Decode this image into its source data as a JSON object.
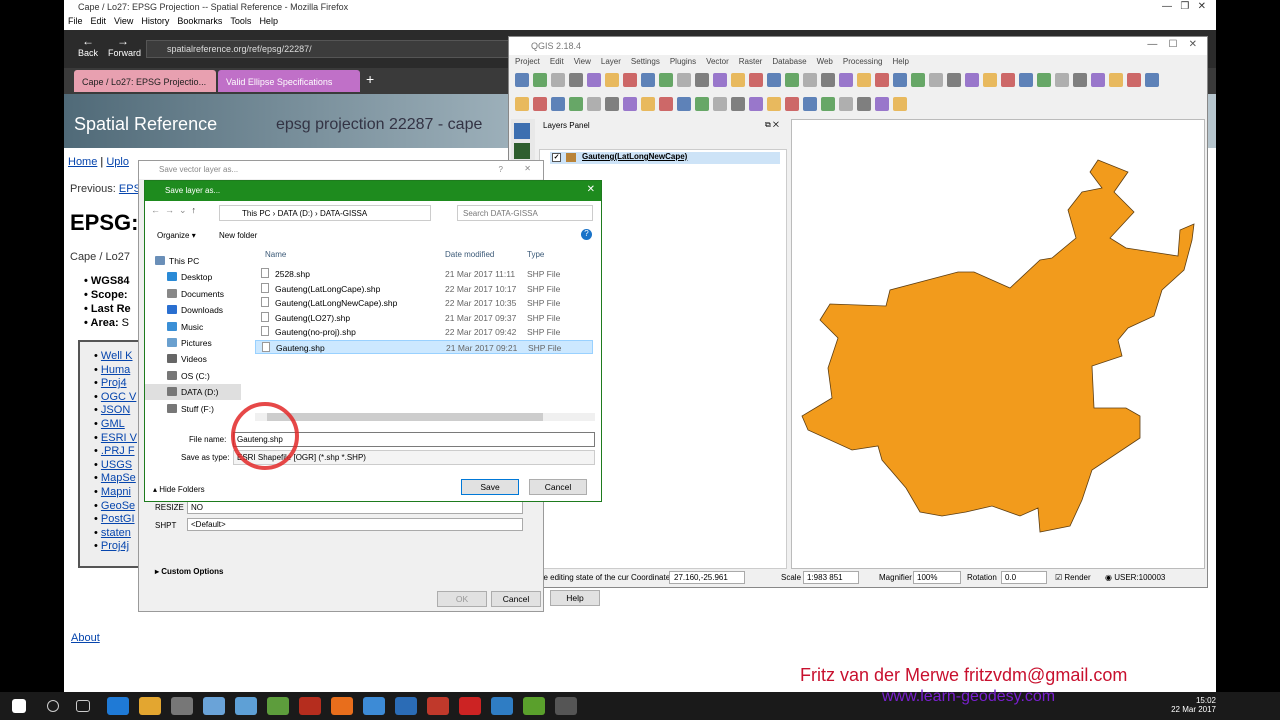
{
  "firefox": {
    "title": "Cape / Lo27: EPSG Projection -- Spatial Reference - Mozilla Firefox",
    "menu": [
      "File",
      "Edit",
      "View",
      "History",
      "Bookmarks",
      "Tools",
      "Help"
    ],
    "back": "Back",
    "forward": "Forward",
    "url": "spatialreference.org/ref/epsg/22287/",
    "tabs": [
      "Cape / Lo27: EPSG Projectio...",
      "Valid Ellipse Specifications"
    ],
    "new_tab": "+"
  },
  "page": {
    "brand": "Spatial Reference",
    "heading_right": "epsg projection 22287 - cape",
    "nav": [
      "Home",
      "Uplo"
    ],
    "previous": "Previous:",
    "previous_link": "EPS",
    "big_title": "EPSG:",
    "subtitle": "Cape / Lo27",
    "props": [
      {
        "k": "WGS84"
      },
      {
        "k": "Scope:"
      },
      {
        "k": "Last Re"
      },
      {
        "k": "Area:",
        "v": "S"
      }
    ],
    "links": [
      "Well K",
      "Huma",
      "Proj4",
      "OGC V",
      "JSON",
      "GML",
      "ESRI V",
      ".PRJ F",
      "USGS",
      "MapSe",
      "Mapni",
      "GeoSe",
      "PostGI",
      "staten",
      "Proj4j"
    ],
    "about": "About"
  },
  "qgis": {
    "title": "QGIS 2.18.4",
    "menu": [
      "Project",
      "Edit",
      "View",
      "Layer",
      "Settings",
      "Plugins",
      "Vector",
      "Raster",
      "Database",
      "Web",
      "Processing",
      "Help"
    ],
    "layers_panel": "Layers Panel",
    "layer": "Gauteng(LatLongNewCape)",
    "status": {
      "msg": "he editing state of the cur",
      "coord_label": "Coordinate",
      "coord": "27.160,-25.961",
      "scale_label": "Scale",
      "scale": "1:983 851",
      "mag_label": "Magnifier",
      "mag": "100%",
      "rot_label": "Rotation",
      "rot": "0.0",
      "render": "Render",
      "crs": "USER:100003"
    },
    "fill_color": "#f29b1c"
  },
  "save_vector": {
    "title": "Save vector layer as...",
    "help": "?",
    "rows": [
      {
        "k": "RESIZE",
        "v": "NO"
      },
      {
        "k": "SHPT",
        "v": "<Default>"
      }
    ],
    "custom": "Custom Options",
    "ok": "OK",
    "cancel": "Cancel",
    "help_btn": "Help"
  },
  "save_layer": {
    "title": "Save layer as...",
    "crumbs": [
      "This PC",
      "DATA (D:)",
      "DATA-GISSA"
    ],
    "search": "Search DATA-GISSA",
    "organize": "Organize",
    "new_folder": "New folder",
    "cols": [
      "Name",
      "Date modified",
      "Type"
    ],
    "nav": [
      "This PC",
      "Desktop",
      "Documents",
      "Downloads",
      "Music",
      "Pictures",
      "Videos",
      "OS (C:)",
      "DATA (D:)",
      "Stuff (F:)"
    ],
    "files": [
      {
        "name": "2528.shp",
        "date": "21 Mar 2017 11:11",
        "type": "SHP File"
      },
      {
        "name": "Gauteng(LatLongCape).shp",
        "date": "22 Mar 2017 10:17",
        "type": "SHP File"
      },
      {
        "name": "Gauteng(LatLongNewCape).shp",
        "date": "22 Mar 2017 10:35",
        "type": "SHP File"
      },
      {
        "name": "Gauteng(LO27).shp",
        "date": "21 Mar 2017 09:37",
        "type": "SHP File"
      },
      {
        "name": "Gauteng(no-proj).shp",
        "date": "22 Mar 2017 09:42",
        "type": "SHP File"
      },
      {
        "name": "Gauteng.shp",
        "date": "21 Mar 2017 09:21",
        "type": "SHP File"
      }
    ],
    "filename_label": "File name:",
    "filename": "Gauteng.shp",
    "type_label": "Save as type:",
    "type": "ESRI Shapefile [OGR] (*.shp *.SHP)",
    "hide_folders": "Hide Folders",
    "save": "Save",
    "cancel": "Cancel"
  },
  "overlay": {
    "author": "Fritz van der Merwe   fritzvdm@gmail.com",
    "site": "www.learn-geodesy.com"
  },
  "taskbar": {
    "time": "15:02",
    "date": "22 Mar 2017"
  }
}
